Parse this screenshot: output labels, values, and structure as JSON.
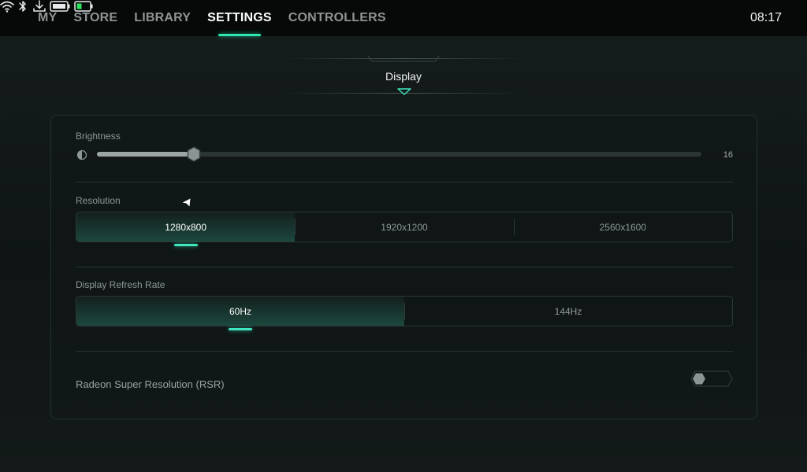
{
  "nav": {
    "items": [
      {
        "label": "MY"
      },
      {
        "label": "STORE"
      },
      {
        "label": "LIBRARY"
      },
      {
        "label": "SETTINGS"
      },
      {
        "label": "CONTROLLERS"
      }
    ],
    "active": "SETTINGS"
  },
  "status": {
    "icons": [
      "wifi-icon",
      "bluetooth-icon",
      "download-icon",
      "controller-battery-icon",
      "battery-icon"
    ],
    "time": "08:17"
  },
  "section": {
    "title": "Display"
  },
  "brightness": {
    "label": "Brightness",
    "value": "16",
    "level": 0.16
  },
  "resolution": {
    "label": "Resolution",
    "options": [
      "1280x800",
      "1920x1200",
      "2560x1600"
    ],
    "selected": "1280x800"
  },
  "refresh_rate": {
    "label": "Display Refresh Rate",
    "options": [
      "60Hz",
      "144Hz"
    ],
    "selected": "60Hz"
  },
  "rsr": {
    "label": "Radeon Super Resolution (RSR)",
    "enabled": false
  },
  "colors": {
    "accent": "#2ee6b1",
    "background": "#121818",
    "topbar": "#070909"
  }
}
